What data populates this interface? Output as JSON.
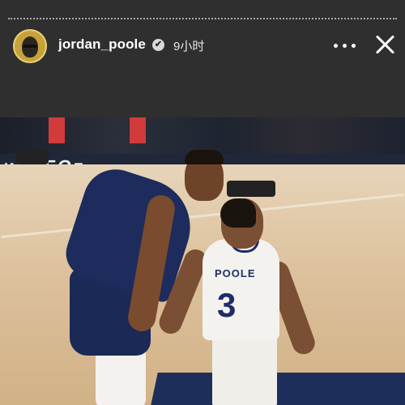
{
  "header": {
    "username": "jordan_poole",
    "verified_badge": "✔",
    "time_ago": "9小时",
    "more_icon": "more-horizontal-icon",
    "close_icon": "close-icon"
  },
  "photo": {
    "banner_text": "ᴎIᴚ FOᴛ",
    "player_name": "POOLE",
    "player_number": "3"
  }
}
